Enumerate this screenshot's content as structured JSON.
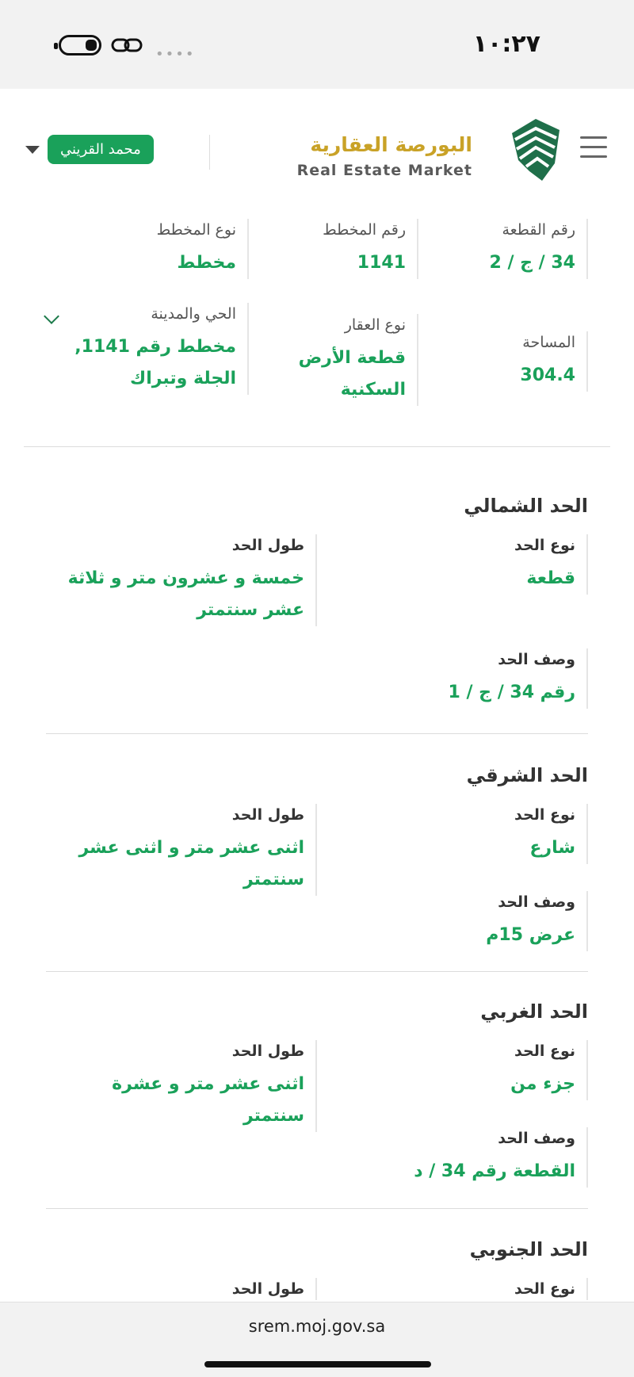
{
  "status": {
    "time": "١٠:٢٧"
  },
  "header": {
    "logo_ar": "البورصة العقارية",
    "logo_en": "Real Estate Market",
    "user_name": "محمد القريني"
  },
  "summary": {
    "plot_number_label": "رقم القطعة",
    "plot_number": "34 / ج / 2",
    "plan_number_label": "رقم المخطط",
    "plan_number": "1141",
    "plan_type_label": "نوع المخطط",
    "plan_type": "مخطط",
    "area_label": "المساحة",
    "area": "304.4",
    "property_type_label": "نوع العقار",
    "property_type": "قطعة الأرض السكنية",
    "district_label": "الحي والمدينة",
    "district": "مخطط رقم 1141, الجلة وتبراك"
  },
  "boundaries": [
    {
      "title": "الحد الشمالي",
      "type_label": "نوع الحد",
      "type": "قطعة",
      "length_label": "طول الحد",
      "length": "خمسة و عشرون متر و ثلاثة عشر سنتمتر",
      "desc_label": "وصف الحد",
      "desc": "رقم 34 / ج / 1"
    },
    {
      "title": "الحد الشرقي",
      "type_label": "نوع الحد",
      "type": "شارع",
      "length_label": "طول الحد",
      "length": "اثنى عشر متر و اثنى عشر سنتمتر",
      "desc_label": "وصف الحد",
      "desc": "عرض 15م"
    },
    {
      "title": "الحد الغربي",
      "type_label": "نوع الحد",
      "type": "جزء من",
      "length_label": "طول الحد",
      "length": "اثنى عشر متر و عشرة سنتمتر",
      "desc_label": "وصف الحد",
      "desc": "القطعة رقم 34 / د"
    },
    {
      "title": "الحد الجنوبي",
      "type_label": "نوع الحد",
      "length_label": "طول الحد"
    }
  ],
  "browser": {
    "url": "srem.moj.gov.sa"
  },
  "colors": {
    "accent": "#1aa15a",
    "gold": "#c9a227"
  }
}
